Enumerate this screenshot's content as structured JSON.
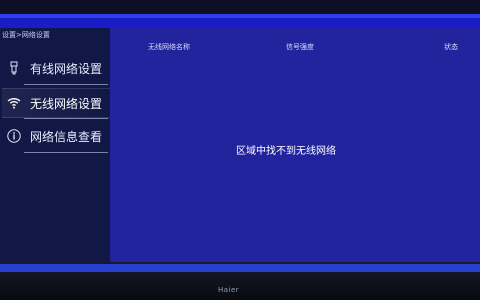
{
  "breadcrumb": "设置>网络设置",
  "sidebar": {
    "items": [
      {
        "label": "有线网络设置",
        "icon": "wired-network-icon"
      },
      {
        "label": "无线网络设置",
        "icon": "wifi-icon"
      },
      {
        "label": "网络信息查看",
        "icon": "info-icon"
      }
    ],
    "selected_index": 1
  },
  "table": {
    "columns": [
      "无线网络名称",
      "信号强度",
      "状态"
    ]
  },
  "status": {
    "message": "区域中找不到无线网络"
  },
  "brand": {
    "text": "Haier"
  },
  "colors": {
    "screen_blue": "#1a1cc8",
    "sidebar_bg": "#121845",
    "main_bg": "#21249c",
    "text_primary": "#ffffff"
  }
}
